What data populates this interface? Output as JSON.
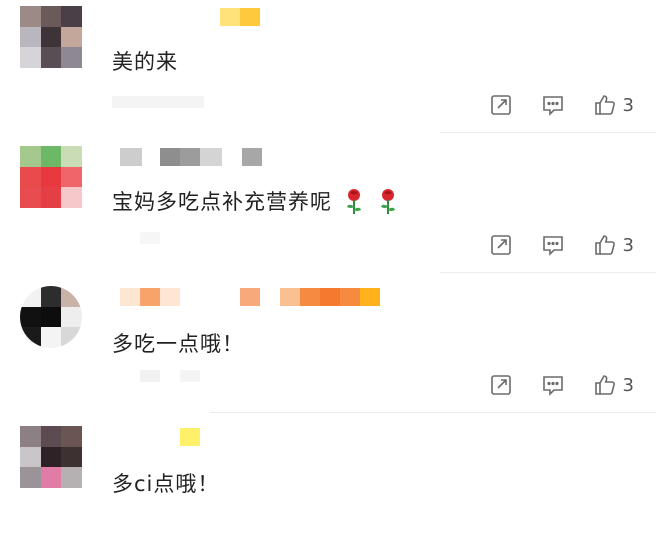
{
  "comments": [
    {
      "text": "美的来",
      "likes": "3",
      "avatar_colors": [
        "#9c8a86",
        "#6a5a5a",
        "#4a3f46",
        "#b9b7bd",
        "#3e3438",
        "#c4a79b",
        "#d6d4d9",
        "#5a4e55",
        "#8e8892"
      ],
      "name_colors": [
        "#ffe27a",
        "#ffffff",
        "#ffc93d"
      ],
      "has_roses": false
    },
    {
      "text": "宝妈多吃点补充营养呢",
      "likes": "3",
      "avatar_colors": [
        "#a4c88e",
        "#6db867",
        "#c9dcb6",
        "#e94b4d",
        "#e83a3e",
        "#f0656a",
        "#e94c50",
        "#e33f44",
        "#f7c8c9"
      ],
      "name_colors": [
        "#cdcdcd",
        "#ffffff",
        "#8e8e8e",
        "#9c9c9c",
        "#d4d4d4",
        "#ffffff",
        "#a7a7a7"
      ],
      "has_roses": true
    },
    {
      "text": "多吃一点哦！",
      "likes": "3",
      "avatar_colors": [
        "#f2f2f2",
        "#2d2d2d",
        "#c9b3a8",
        "#111111",
        "#0d0d0d",
        "#eeeeee",
        "#1a1a1a",
        "#f4f4f4",
        "#d8d8d8"
      ],
      "name_colors": [
        "#fde7d3",
        "#f7a36a",
        "#fde6d2",
        "#ffffff",
        "#f8a97b",
        "#ffffff",
        "#fbc091",
        "#f58a40",
        "#f57a2d",
        "#ffb21c"
      ],
      "has_roses": false
    },
    {
      "text": "多ci点哦！",
      "likes": "",
      "avatar_colors": [
        "#8d8085",
        "#5c4b50",
        "#6b5552",
        "#c9c5c9",
        "#2e2226",
        "#3d3231",
        "#9a9397",
        "#e07ca6",
        "#b5b0b2"
      ],
      "name_colors": [
        "#fff06a"
      ],
      "has_roses": false
    }
  ],
  "icons": {
    "share": "share-icon",
    "reply": "comment-icon",
    "like": "thumbs-up-icon",
    "rose": "rose-emoji-icon"
  },
  "colors": {
    "text": "#222222",
    "icon": "#6b6b6b",
    "divider": "#ececec"
  }
}
